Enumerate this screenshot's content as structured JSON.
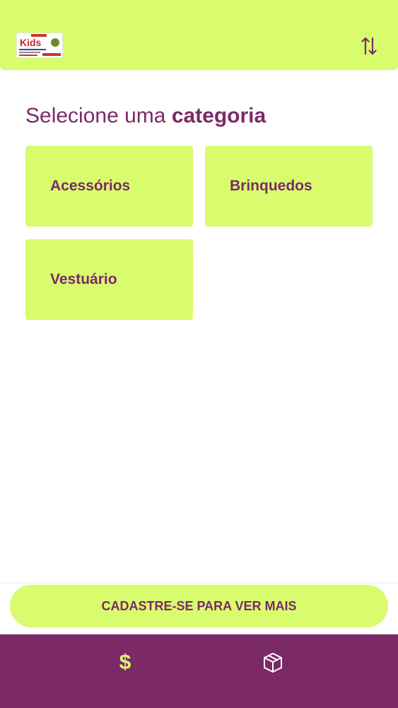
{
  "header": {
    "logo_text": "Kids",
    "sort_icon": "sort-arrows-icon"
  },
  "title": {
    "light": "Selecione uma",
    "bold": "categoria"
  },
  "categories": [
    {
      "label": "Acessórios"
    },
    {
      "label": "Brinquedos"
    },
    {
      "label": "Vestuário"
    }
  ],
  "cta": {
    "label": "CADASTRE-SE PARA VER MAIS"
  },
  "bottom_nav": {
    "items": [
      {
        "icon": "dollar-icon",
        "glyph": "$"
      },
      {
        "icon": "package-icon"
      }
    ]
  },
  "colors": {
    "accent": "#d9fb6e",
    "brand": "#7b2a67",
    "background": "#ffffff"
  }
}
